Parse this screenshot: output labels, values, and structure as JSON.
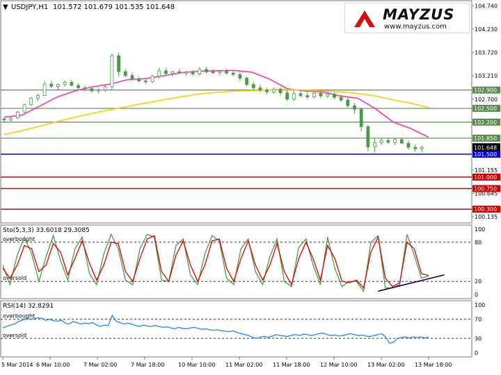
{
  "header": {
    "dropdown_icon": "triangle-down-icon",
    "symbol": "USDJPY,H1",
    "ohlc": "101.572 101.679 101.535 101.648"
  },
  "logo": {
    "name": "MAYZUS",
    "url": "www.mayzus.com"
  },
  "chart_data": {
    "type": "line",
    "x_labels": [
      "5 Mar 2014",
      "6 Mar 10:00",
      "7 Mar 02:00",
      "7 Mar 18:00",
      "10 Mar 10:00",
      "11 Mar 02:00",
      "11 Mar 18:00",
      "12 Mar 10:00",
      "13 Mar 02:00",
      "13 Mar 18:00"
    ],
    "main": {
      "ylim": [
        100.0,
        104.85
      ],
      "y_ticks": [
        "104.740",
        "104.230",
        "103.720",
        "103.210",
        "102.700",
        "102.190",
        "101.680",
        "101.155",
        "100.645",
        "100.135"
      ],
      "horizontal_levels": [
        {
          "value": 102.9,
          "label": "102.900",
          "color": "#5a8a50"
        },
        {
          "value": 102.5,
          "label": "102.500",
          "color": "#5a8a50"
        },
        {
          "value": 102.2,
          "label": "102.200",
          "color": "#5a8a50"
        },
        {
          "value": 101.85,
          "label": "101.850",
          "color": "#5a8a50"
        },
        {
          "value": 101.5,
          "label": "101.500",
          "color": "#0000dd"
        },
        {
          "value": 101.0,
          "label": "101.000",
          "color": "#cc0000"
        },
        {
          "value": 100.75,
          "label": "100.750",
          "color": "#cc0000"
        },
        {
          "value": 100.3,
          "label": "100.300",
          "color": "#cc0000"
        }
      ],
      "price_marker": {
        "value": 101.648,
        "label": "101.648"
      },
      "series": [
        {
          "color": "#ff33aa",
          "values": [
            102.31,
            102.35,
            102.55,
            102.75,
            102.88,
            102.97,
            103.03,
            103.13,
            103.15,
            103.21,
            103.28,
            103.31,
            103.32,
            103.33,
            103.29,
            103.14,
            102.93,
            102.88,
            102.86,
            102.77,
            102.72,
            102.49,
            102.2,
            102.06,
            101.87
          ]
        },
        {
          "color": "#ffcc00",
          "values": [
            101.93,
            102.02,
            102.13,
            102.24,
            102.34,
            102.43,
            102.51,
            102.59,
            102.67,
            102.74,
            102.81,
            102.85,
            102.88,
            102.89,
            102.91,
            102.91,
            102.89,
            102.87,
            102.84,
            102.79,
            102.7,
            102.62,
            102.52
          ]
        }
      ],
      "candles": [
        [
          102.27,
          102.3,
          102.2,
          102.25
        ],
        [
          102.25,
          102.33,
          102.22,
          102.29
        ],
        [
          102.29,
          102.45,
          102.27,
          102.42
        ],
        [
          102.42,
          102.6,
          102.4,
          102.58
        ],
        [
          102.58,
          102.75,
          102.55,
          102.72
        ],
        [
          102.72,
          102.82,
          102.66,
          102.78
        ],
        [
          102.78,
          103.1,
          102.77,
          103.03
        ],
        [
          103.03,
          103.1,
          102.94,
          102.98
        ],
        [
          102.98,
          103.05,
          102.9,
          103.02
        ],
        [
          103.02,
          103.11,
          102.97,
          103.07
        ],
        [
          103.07,
          103.12,
          102.99,
          103.0
        ],
        [
          103.0,
          103.05,
          102.9,
          102.95
        ],
        [
          102.95,
          103.0,
          102.88,
          102.93
        ],
        [
          102.93,
          102.98,
          102.84,
          102.88
        ],
        [
          102.88,
          102.94,
          102.82,
          102.9
        ],
        [
          102.9,
          103.0,
          102.86,
          102.97
        ],
        [
          102.97,
          103.7,
          102.9,
          103.65
        ],
        [
          103.65,
          103.72,
          103.2,
          103.3
        ],
        [
          103.3,
          103.36,
          103.18,
          103.22
        ],
        [
          103.22,
          103.28,
          103.1,
          103.14
        ],
        [
          103.14,
          103.2,
          103.06,
          103.1
        ],
        [
          103.1,
          103.16,
          103.03,
          103.08
        ],
        [
          103.08,
          103.24,
          103.05,
          103.2
        ],
        [
          103.2,
          103.38,
          103.15,
          103.32
        ],
        [
          103.32,
          103.38,
          103.22,
          103.26
        ],
        [
          103.26,
          103.32,
          103.2,
          103.3
        ],
        [
          103.3,
          103.36,
          103.24,
          103.27
        ],
        [
          103.27,
          103.32,
          103.21,
          103.29
        ],
        [
          103.29,
          103.34,
          103.22,
          103.25
        ],
        [
          103.25,
          103.4,
          103.22,
          103.35
        ],
        [
          103.35,
          103.4,
          103.26,
          103.3
        ],
        [
          103.3,
          103.36,
          103.24,
          103.28
        ],
        [
          103.28,
          103.34,
          103.22,
          103.31
        ],
        [
          103.31,
          103.36,
          103.24,
          103.27
        ],
        [
          103.27,
          103.32,
          103.2,
          103.24
        ],
        [
          103.24,
          103.28,
          103.1,
          103.16
        ],
        [
          103.16,
          103.2,
          102.98,
          103.02
        ],
        [
          103.02,
          103.08,
          102.9,
          102.95
        ],
        [
          102.95,
          103.02,
          102.85,
          102.9
        ],
        [
          102.9,
          102.96,
          102.8,
          102.86
        ],
        [
          102.86,
          102.96,
          102.82,
          102.92
        ],
        [
          102.92,
          102.96,
          102.78,
          102.84
        ],
        [
          102.84,
          102.9,
          102.66,
          102.7
        ],
        [
          102.7,
          102.88,
          102.66,
          102.82
        ],
        [
          102.82,
          102.9,
          102.74,
          102.78
        ],
        [
          102.78,
          102.86,
          102.7,
          102.75
        ],
        [
          102.75,
          102.86,
          102.72,
          102.83
        ],
        [
          102.83,
          102.88,
          102.72,
          102.77
        ],
        [
          102.77,
          102.85,
          102.73,
          102.81
        ],
        [
          102.81,
          102.86,
          102.7,
          102.74
        ],
        [
          102.74,
          102.8,
          102.64,
          102.68
        ],
        [
          102.68,
          102.76,
          102.52,
          102.56
        ],
        [
          102.56,
          102.62,
          102.38,
          102.48
        ],
        [
          102.48,
          102.52,
          102.0,
          102.1
        ],
        [
          102.1,
          102.14,
          101.56,
          101.66
        ],
        [
          101.66,
          101.84,
          101.55,
          101.75
        ],
        [
          101.75,
          101.86,
          101.7,
          101.8
        ],
        [
          101.8,
          101.86,
          101.72,
          101.76
        ],
        [
          101.76,
          101.86,
          101.7,
          101.82
        ],
        [
          101.82,
          101.86,
          101.72,
          101.74
        ],
        [
          101.74,
          101.8,
          101.6,
          101.65
        ],
        [
          101.65,
          101.72,
          101.56,
          101.62
        ],
        [
          101.62,
          101.68,
          101.54,
          101.648
        ]
      ]
    },
    "stoch": {
      "label": "Sto(5,3,3)",
      "values_text": "33.6018 29.3085",
      "levels": [
        {
          "value": 80,
          "label": "overbought"
        },
        {
          "value": 20,
          "label": "oversold"
        }
      ],
      "y_ticks": [
        "100",
        "80",
        "20",
        "0"
      ],
      "main_line": {
        "color": "#4a9a4a",
        "values": [
          45,
          15,
          60,
          88,
          62,
          20,
          58,
          90,
          52,
          22,
          70,
          88,
          32,
          15,
          62,
          92,
          70,
          22,
          15,
          70,
          92,
          88,
          22,
          20,
          75,
          85,
          30,
          15,
          62,
          90,
          82,
          25,
          15,
          70,
          85,
          35,
          15,
          58,
          85,
          20,
          12,
          72,
          85,
          45,
          15,
          88,
          40,
          12,
          20,
          20,
          5,
          80,
          90,
          10,
          10,
          15,
          92,
          60,
          25,
          28
        ]
      },
      "signal_line": {
        "color": "#dd0000",
        "values": [
          40,
          25,
          45,
          75,
          70,
          35,
          45,
          78,
          65,
          30,
          55,
          82,
          48,
          22,
          45,
          80,
          78,
          35,
          20,
          55,
          85,
          90,
          35,
          20,
          60,
          82,
          45,
          20,
          45,
          82,
          85,
          40,
          20,
          55,
          82,
          45,
          22,
          45,
          78,
          35,
          15,
          55,
          80,
          55,
          22,
          75,
          55,
          20,
          18,
          22,
          10,
          65,
          88,
          25,
          12,
          18,
          80,
          70,
          32,
          29
        ]
      },
      "trendline": {
        "from": [
          52,
          5
        ],
        "to": [
          60,
          30
        ],
        "color": "#000080"
      }
    },
    "rsi": {
      "label": "RSI(14)",
      "value_text": "32.8291",
      "levels": [
        {
          "value": 70,
          "label": "overbought"
        },
        {
          "value": 30,
          "label": "oversold"
        }
      ],
      "y_ticks": [
        "100",
        "70",
        "30",
        "0"
      ],
      "color": "#1e88e5",
      "values": [
        52,
        55,
        58,
        60,
        65,
        68,
        72,
        70,
        71,
        73,
        72,
        68,
        70,
        67,
        66,
        68,
        62,
        60,
        65,
        63,
        60,
        62,
        61,
        63,
        58,
        55,
        58,
        57,
        78,
        66,
        63,
        60,
        62,
        60,
        57,
        55,
        58,
        56,
        55,
        57,
        55,
        53,
        54,
        52,
        50,
        53,
        51,
        50,
        52,
        53,
        51,
        49,
        50,
        48,
        47,
        48,
        46,
        45,
        44,
        46,
        42,
        40,
        38,
        36,
        32,
        30,
        33,
        34,
        32,
        35,
        38,
        36,
        35,
        34,
        37,
        38,
        36,
        39,
        38,
        36,
        38,
        40,
        41,
        38,
        36,
        37,
        35,
        36,
        38,
        40,
        38,
        36,
        37,
        35,
        34,
        36,
        38,
        40,
        33,
        20,
        22,
        30,
        32,
        33,
        31,
        33,
        32,
        33,
        31,
        33
      ]
    }
  }
}
